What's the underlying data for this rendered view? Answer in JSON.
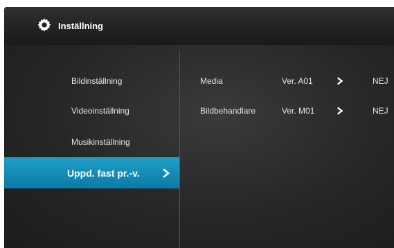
{
  "header": {
    "title": "Inställning",
    "icon": "gear-icon"
  },
  "menu": {
    "items": [
      {
        "label": "Bildinställning"
      },
      {
        "label": "Videoinställning"
      },
      {
        "label": "Musikinställning"
      },
      {
        "label": "Uppd. fast pr.-v.",
        "selected": true
      }
    ]
  },
  "firmware": {
    "rows": [
      {
        "name": "Media",
        "version": "Ver. A01",
        "value": "NEJ"
      },
      {
        "name": "Bildbehandlare",
        "version": "Ver. M01",
        "value": "NEJ"
      }
    ]
  },
  "colors": {
    "accent": "#1793bd",
    "background": "#262626",
    "text": "#e6e6e6"
  }
}
